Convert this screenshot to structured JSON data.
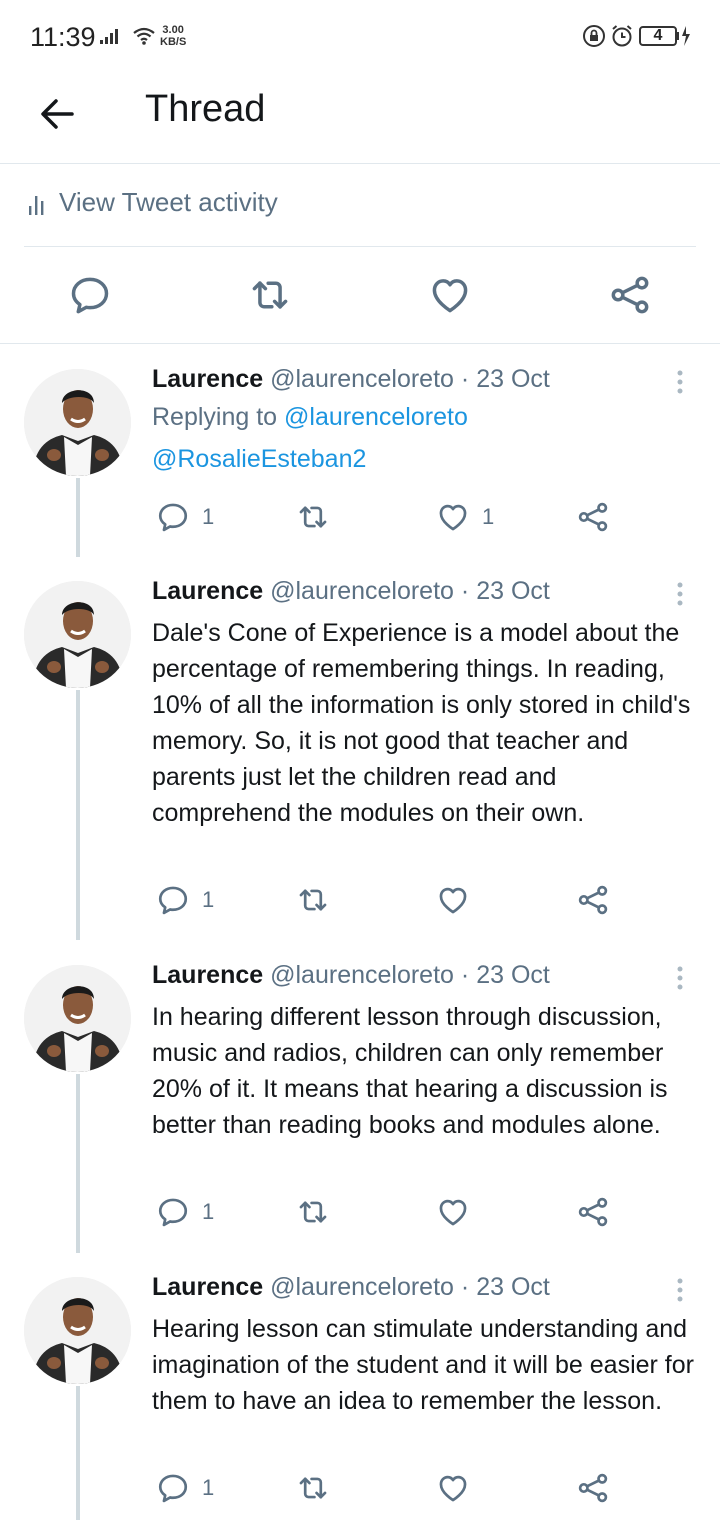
{
  "status_bar": {
    "time": "11:39",
    "net_speed_value": "3.00",
    "net_speed_unit": "KB/S",
    "battery_level": "4",
    "icons": [
      "signal-icon",
      "wifi-icon",
      "lock-icon",
      "alarm-icon",
      "battery-icon"
    ]
  },
  "header": {
    "title": "Thread"
  },
  "activity": {
    "label": "View Tweet activity"
  },
  "colors": {
    "text": "#14171a",
    "secondary": "#5b7083",
    "link": "#1b95e0",
    "divider": "#e1e8ed",
    "thread_line": "#cfd9de"
  },
  "tweets": [
    {
      "name": "Laurence",
      "handle": "@laurenceloreto",
      "separator": "·",
      "date": "23 Oct",
      "replying_prefix": "Replying to",
      "replying_to": "@laurenceloreto",
      "replying_to_2": "@RosalieEsteban2",
      "reply_count": "1",
      "retweet_count": "",
      "like_count": "1"
    },
    {
      "name": "Laurence",
      "handle": "@laurenceloreto",
      "separator": "·",
      "date": "23 Oct",
      "text": "Dale's Cone of Experience is a model about the percentage of remembering things. In reading, 10% of all the information is only stored in child's memory. So, it is not good that teacher and parents just let the children read and comprehend the modules on their own.",
      "reply_count": "1",
      "retweet_count": "",
      "like_count": ""
    },
    {
      "name": "Laurence",
      "handle": "@laurenceloreto",
      "separator": "·",
      "date": "23 Oct",
      "text": "In hearing different lesson through discussion, music and radios, children can only remember 20% of it. It means that hearing a discussion is better than reading books and modules alone.",
      "reply_count": "1",
      "retweet_count": "",
      "like_count": ""
    },
    {
      "name": "Laurence",
      "handle": "@laurenceloreto",
      "separator": "·",
      "date": "23 Oct",
      "text": "Hearing lesson can stimulate understanding and imagination of the student and it will be easier for them to have an idea to remember the lesson.",
      "reply_count": "1",
      "retweet_count": "",
      "like_count": ""
    }
  ]
}
